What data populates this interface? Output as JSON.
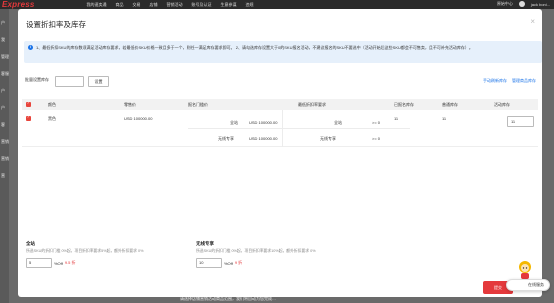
{
  "background": {
    "logo": "Express",
    "nav": [
      "我的速卖通",
      "商品",
      "交易",
      "店铺",
      "营销活动",
      "账号及认证",
      "生意参谋",
      "违规"
    ],
    "right": [
      "原始中心",
      "jack boni..."
    ],
    "side_labels": [
      "户",
      "我",
      "管理",
      "客服",
      "户",
      "户",
      "客",
      "营销",
      "营销",
      "营",
      "营销",
      "营"
    ],
    "bottom_text": "请选择店铺营销活动商品范围，我们将自动为您完成…"
  },
  "modal": {
    "title": "设置折扣率及库存",
    "close": "×",
    "notice": "1、最低折扣SKU的库存数须满足活动库存要求，若最低价SKU价格一致且多于一个，则任一满足库存要求即可。 2、请勾选库存设置大于0的SKU报名活动，不建议报名的SKU不要选中（活动开始后这些SKU都会不可售卖，且不可补充活动库存）。",
    "batch": {
      "label": "批量设置库存",
      "input_value": "",
      "button": "设置"
    },
    "links": [
      "手动刷新库存",
      "管理商品库存"
    ],
    "table": {
      "headers": [
        "颜色",
        "零售价",
        "报名门槛价",
        "最低折扣率要求",
        "已报名库存",
        "普通库存",
        "活动库存"
      ],
      "row": {
        "color": "黑色",
        "retail": "USD 100000.00",
        "thresholds": [
          {
            "name": "全站",
            "price": "USD 100000.00",
            "req_name": "全站",
            "req_val": ">= 0"
          },
          {
            "name": "无线专享",
            "price": "USD 100000.00",
            "req_name": "无线专享",
            "req_val": ">= 0"
          }
        ],
        "registered_stock": "11",
        "normal_stock": "11",
        "activity_stock": "11"
      }
    },
    "discounts": [
      {
        "title": "全站",
        "desc": "所选SKU的折扣门槛 0%起，项目折扣率要求5%起，额外折扣要求 0%",
        "value": "5",
        "suffix": "%Off",
        "result": "9.5 折"
      },
      {
        "title": "无线专享",
        "desc": "所选SKU的折扣门槛 0%起，项目折扣率要求10%起，额外折扣要求 0%",
        "value": "10",
        "suffix": "%Off",
        "result": "9 折"
      }
    ],
    "submit": "提交"
  },
  "service": {
    "label": "在线服务"
  }
}
